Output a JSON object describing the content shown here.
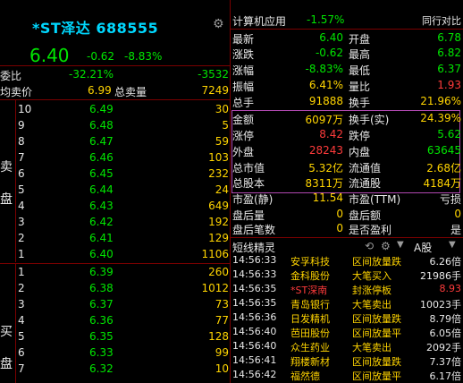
{
  "header": {
    "title": "*ST泽达 688555",
    "price": "6.40",
    "change": "-0.62",
    "change_pct": "-8.83%"
  },
  "summary": {
    "weibi_label": "委比",
    "weibi_pct": "-32.21%",
    "weibi_val": "-3532",
    "junmai_label": "均卖价",
    "junmai_val": "6.99",
    "zongmai_label": "总卖量",
    "zongmai_val": "7249"
  },
  "side_labels": {
    "sell_1": "卖",
    "sell_2": "盘",
    "buy_1": "买",
    "buy_2": "盘"
  },
  "sell_book": [
    {
      "level": "10",
      "price": "6.49",
      "vol": "30"
    },
    {
      "level": "9",
      "price": "6.48",
      "vol": "5"
    },
    {
      "level": "8",
      "price": "6.47",
      "vol": "59"
    },
    {
      "level": "7",
      "price": "6.46",
      "vol": "103"
    },
    {
      "level": "6",
      "price": "6.45",
      "vol": "232"
    },
    {
      "level": "5",
      "price": "6.44",
      "vol": "24"
    },
    {
      "level": "4",
      "price": "6.43",
      "vol": "649"
    },
    {
      "level": "3",
      "price": "6.42",
      "vol": "192"
    },
    {
      "level": "2",
      "price": "6.41",
      "vol": "129"
    },
    {
      "level": "1",
      "price": "6.40",
      "vol": "1106"
    }
  ],
  "buy_book": [
    {
      "level": "1",
      "price": "6.39",
      "vol": "260"
    },
    {
      "level": "2",
      "price": "6.38",
      "vol": "1012"
    },
    {
      "level": "3",
      "price": "6.37",
      "vol": "73"
    },
    {
      "level": "4",
      "price": "6.36",
      "vol": "77"
    },
    {
      "level": "5",
      "price": "6.35",
      "vol": "128"
    },
    {
      "level": "6",
      "price": "6.33",
      "vol": "99"
    },
    {
      "level": "7",
      "price": "6.32",
      "vol": "10"
    }
  ],
  "right_header": {
    "sector": "计算机应用",
    "sector_pct": "-1.57%",
    "compare": "同行对比"
  },
  "stats": [
    {
      "l1": "最新",
      "v1": "6.40",
      "c1": "green",
      "l2": "开盘",
      "v2": "6.78",
      "c2": "green"
    },
    {
      "l1": "涨跌",
      "v1": "-0.62",
      "c1": "green",
      "l2": "最高",
      "v2": "6.82",
      "c2": "green"
    },
    {
      "l1": "涨幅",
      "v1": "-8.83%",
      "c1": "green",
      "l2": "最低",
      "v2": "6.37",
      "c2": "green"
    },
    {
      "l1": "振幅",
      "v1": "6.41%",
      "c1": "yellow",
      "l2": "量比",
      "v2": "1.93",
      "c2": "red"
    },
    {
      "l1": "总手",
      "v1": "91888",
      "c1": "yellow",
      "l2": "换手",
      "v2": "21.96%",
      "c2": "yellow"
    },
    {
      "l1": "金额",
      "v1": "6097万",
      "c1": "yellow",
      "l2": "换手(实)",
      "v2": "24.39%",
      "c2": "yellow"
    },
    {
      "l1": "涨停",
      "v1": "8.42",
      "c1": "red",
      "l2": "跌停",
      "v2": "5.62",
      "c2": "green"
    },
    {
      "l1": "外盘",
      "v1": "28243",
      "c1": "red",
      "l2": "内盘",
      "v2": "63645",
      "c2": "green"
    },
    {
      "l1": "总市值",
      "v1": "5.32亿",
      "c1": "yellow",
      "l2": "流通值",
      "v2": "2.68亿",
      "c2": "yellow"
    },
    {
      "l1": "总股本",
      "v1": "8311万",
      "c1": "yellow",
      "l2": "流通股",
      "v2": "4184万",
      "c2": "yellow"
    },
    {
      "l1": "市盈(静)",
      "v1": "11.54",
      "c1": "yellow",
      "l2": "市盈(TTM)",
      "v2": "亏损",
      "c2": "white"
    },
    {
      "l1": "盘后量",
      "v1": "0",
      "c1": "yellow",
      "l2": "盘后额",
      "v2": "0",
      "c2": "yellow"
    },
    {
      "l1": "盘后笔数",
      "v1": "0",
      "c1": "yellow",
      "l2": "是否盈利",
      "v2": "是",
      "c2": "white"
    }
  ],
  "short_line": {
    "title": "短线精灵",
    "market": "A股"
  },
  "ticks": [
    {
      "time": "14:56:33",
      "name": "安孚科技",
      "event": "区间放量跌",
      "val": "6.26倍",
      "vc": "white"
    },
    {
      "time": "14:56:33",
      "name": "金科股份",
      "event": "大笔买入",
      "val": "21986手",
      "vc": "white"
    },
    {
      "time": "14:56:35",
      "name": "*ST深南",
      "event": "封涨停板",
      "val": "8.93",
      "vc": "red"
    },
    {
      "time": "14:56:35",
      "name": "青岛银行",
      "event": "大笔卖出",
      "val": "10023手",
      "vc": "white"
    },
    {
      "time": "14:56:36",
      "name": "日发精机",
      "event": "区间放量跌",
      "val": "8.79倍",
      "vc": "white"
    },
    {
      "time": "14:56:40",
      "name": "芭田股份",
      "event": "区间放量平",
      "val": "6.05倍",
      "vc": "white"
    },
    {
      "time": "14:56:40",
      "name": "众生药业",
      "event": "大笔卖出",
      "val": "2092手",
      "vc": "white"
    },
    {
      "time": "14:56:41",
      "name": "翔楼新材",
      "event": "区间放量跌",
      "val": "7.37倍",
      "vc": "white"
    },
    {
      "time": "14:56:42",
      "name": "福然德",
      "event": "区间放量平",
      "val": "6.17倍",
      "vc": "white"
    }
  ]
}
